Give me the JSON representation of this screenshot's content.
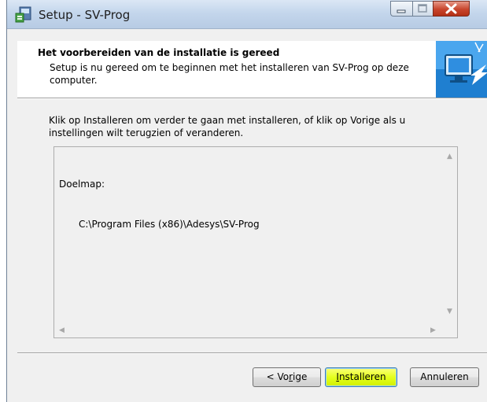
{
  "window": {
    "title": "Setup - SV-Prog"
  },
  "header": {
    "title": "Het voorbereiden van de installatie is gereed",
    "description": "Setup is nu gereed om te beginnen met het installeren van SV-Prog op deze computer."
  },
  "body": {
    "intro": "Klik op Installeren om verder te gaan met installeren, of klik op Vorige als u instellingen wilt terugzien of veranderen."
  },
  "memo": {
    "label": "Doelmap:",
    "value": "C:\\Program Files (x86)\\Adesys\\SV-Prog"
  },
  "buttons": {
    "back": {
      "pre": "< Vo",
      "accel": "r",
      "post": "ige"
    },
    "install": {
      "pre": "",
      "accel": "I",
      "post": "nstalleren"
    },
    "cancel": "Annuleren"
  },
  "colors": {
    "install_highlight": "#e4ff1e",
    "close_button": "#c8452c",
    "titlebar": "#c4d6ec"
  }
}
